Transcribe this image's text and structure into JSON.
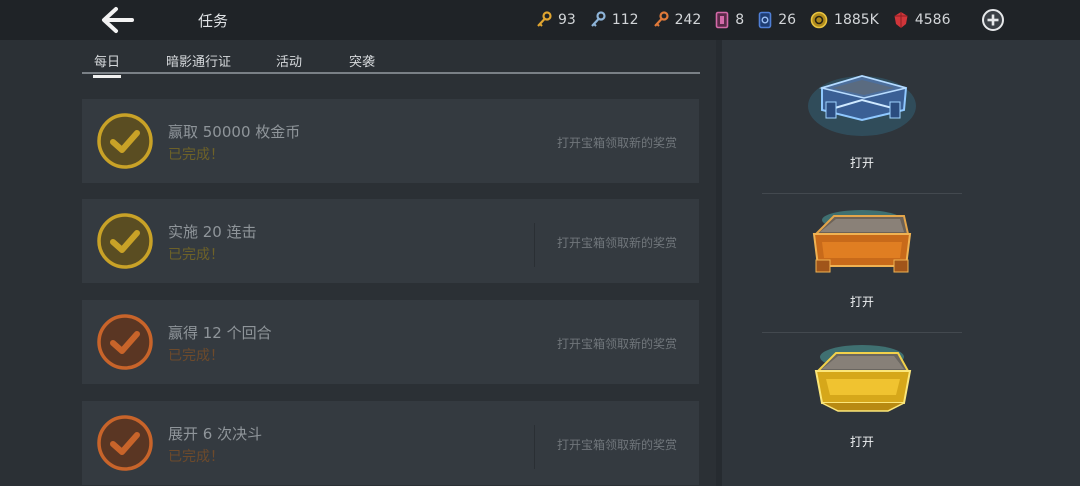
{
  "header": {
    "title": "任务",
    "currencies": [
      {
        "icon": "gold-key-icon",
        "value": "93",
        "color": "#e0a530"
      },
      {
        "icon": "silver-key-icon",
        "value": "112",
        "color": "#8eb4d8"
      },
      {
        "icon": "bronze-key-icon",
        "value": "242",
        "color": "#e07a3a"
      },
      {
        "icon": "ticket-icon",
        "value": "8",
        "color": "#d36aa8"
      },
      {
        "icon": "card-icon",
        "value": "26",
        "color": "#4f7fd6"
      },
      {
        "icon": "coin-icon",
        "value": "1885K",
        "color": "#e8c440"
      },
      {
        "icon": "gem-icon",
        "value": "4586",
        "color": "#d0353a"
      }
    ]
  },
  "tabs": [
    "每日",
    "暗影通行证",
    "活动",
    "突袭"
  ],
  "quests": [
    {
      "title": "赢取 50000 枚金币",
      "status": "已完成！",
      "hint": "打开宝箱领取新的奖赏",
      "badge": "gold"
    },
    {
      "title": "实施 20 连击",
      "status": "已完成！",
      "hint": "打开宝箱领取新的奖赏",
      "badge": "gold"
    },
    {
      "title": "赢得 12 个回合",
      "status": "已完成！",
      "hint": "打开宝箱领取新的奖赏",
      "badge": "bronze"
    },
    {
      "title": "展开 6 次决斗",
      "status": "已完成！",
      "hint": "打开宝箱领取新的奖赏",
      "badge": "bronze"
    }
  ],
  "chests": [
    {
      "type": "blue-chest-icon",
      "label": "打开"
    },
    {
      "type": "orange-chest-icon",
      "label": "打开"
    },
    {
      "type": "gold-chest-icon",
      "label": "打开"
    }
  ],
  "colors": {
    "gold_badge": "#c9a227",
    "bronze_badge": "#c8642a",
    "gold_status": "#6d6128",
    "bronze_status": "#6d4a2b"
  }
}
